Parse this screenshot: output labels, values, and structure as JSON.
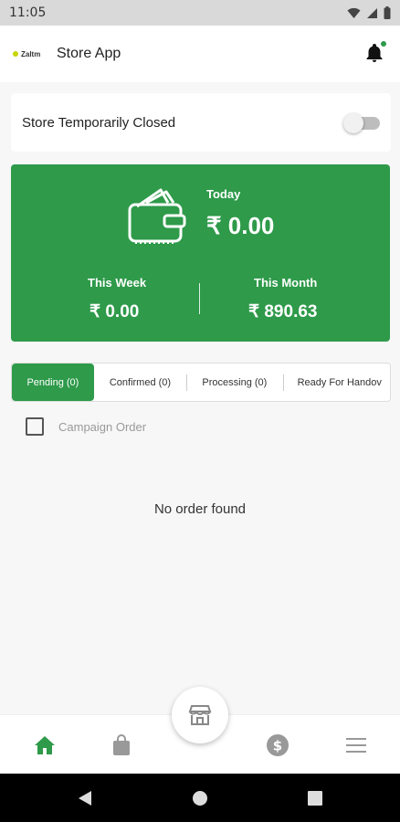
{
  "status_bar": {
    "time": "11:05"
  },
  "header": {
    "logo_text": "Zaltm",
    "title": "Store App"
  },
  "store_status": {
    "label": "Store Temporarily Closed",
    "toggle_on": false
  },
  "earnings": {
    "today_label": "Today",
    "today_value": "₹ 0.00",
    "week_label": "This Week",
    "week_value": "₹ 0.00",
    "month_label": "This Month",
    "month_value": "₹ 890.63"
  },
  "tabs": [
    {
      "label": "Pending (0)",
      "active": true
    },
    {
      "label": "Confirmed (0)",
      "active": false
    },
    {
      "label": "Processing (0)",
      "active": false
    },
    {
      "label": "Ready For Handov",
      "active": false
    }
  ],
  "filter": {
    "campaign_label": "Campaign Order",
    "checked": false
  },
  "orders": {
    "empty_message": "No order found"
  },
  "colors": {
    "accent": "#2e9a4a",
    "background": "#f7f7f7"
  },
  "bottom_nav": [
    "home-icon",
    "shopping-bag-icon",
    "store-icon",
    "dollar-icon",
    "menu-icon"
  ]
}
